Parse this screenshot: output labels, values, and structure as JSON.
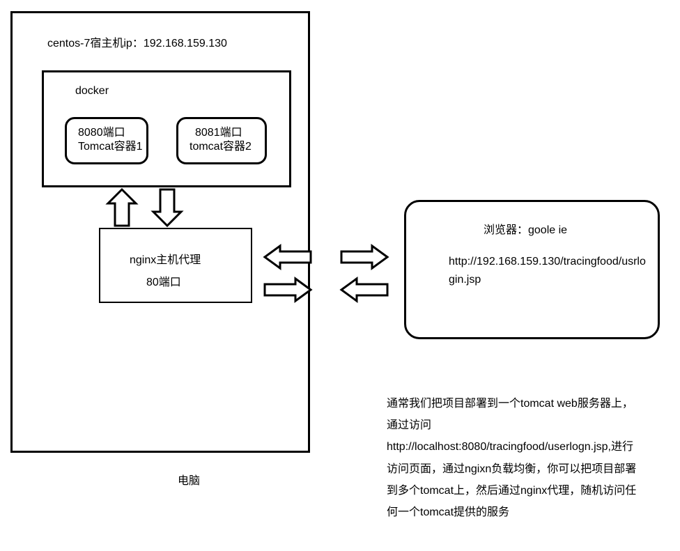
{
  "host_label": "centos-7宿主机ip：192.168.159.130",
  "docker_label": "docker",
  "tomcat1": {
    "port": "8080端口",
    "name": "Tomcat容器1"
  },
  "tomcat2": {
    "port": "8081端口",
    "name": "tomcat容器2"
  },
  "nginx": {
    "title": "nginx主机代理",
    "port": "80端口"
  },
  "computer_label": "电脑",
  "browser": {
    "title": "浏览器：goole ie",
    "url": "http://192.168.159.130/tracingfood/usrlogin.jsp"
  },
  "note": "通常我们把项目部署到一个tomcat web服务器上，通过访问http://localhost:8080/tracingfood/userlogn.jsp,进行访问页面，通过ngixn负载均衡，你可以把项目部署到多个tomcat上，然后通过nginx代理，随机访问任何一个tomcat提供的服务"
}
